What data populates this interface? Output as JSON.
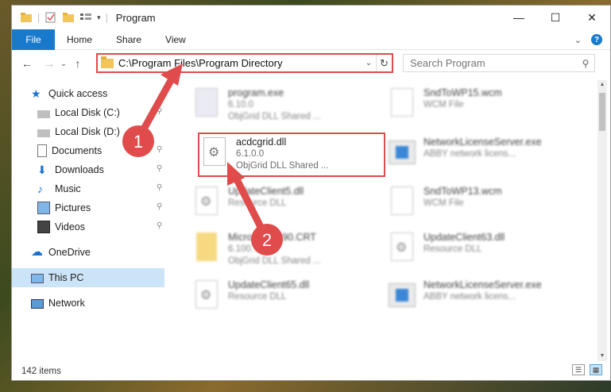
{
  "window": {
    "title": "Program",
    "controls": {
      "minimize": "—",
      "maximize": "☐",
      "close": "✕"
    }
  },
  "ribbon": {
    "file_tab": "File",
    "tabs": [
      "Home",
      "Share",
      "View"
    ]
  },
  "address_bar": {
    "path": "C:\\Program Files\\Program Directory"
  },
  "search": {
    "placeholder": "Search Program"
  },
  "sidebar": {
    "items": [
      {
        "label": "Quick access",
        "icon": "star-icon"
      },
      {
        "label": "Local Disk (C:)",
        "icon": "drive-icon"
      },
      {
        "label": "Local Disk (D:)",
        "icon": "drive-icon"
      },
      {
        "label": "Documents",
        "icon": "documents-icon"
      },
      {
        "label": "Downloads",
        "icon": "download-icon"
      },
      {
        "label": "Music",
        "icon": "music-icon"
      },
      {
        "label": "Pictures",
        "icon": "pictures-icon"
      },
      {
        "label": "Videos",
        "icon": "videos-icon"
      },
      {
        "label": "OneDrive",
        "icon": "cloud-icon"
      },
      {
        "label": "This PC",
        "icon": "computer-icon"
      },
      {
        "label": "Network",
        "icon": "network-icon"
      }
    ]
  },
  "files": [
    {
      "name": "program.exe",
      "line2": "6.10.0",
      "line3": "ObjGrid DLL Shared ...",
      "icon": "exe-icon"
    },
    {
      "name": "SndToWP15.wcm",
      "line2": "WCM File",
      "line3": "",
      "icon": "document-icon"
    },
    {
      "name": "acdcgrid.dll",
      "line2": "6.1.0.0",
      "line3": "ObjGrid DLL Shared ...",
      "icon": "dll-gear-icon"
    },
    {
      "name": "NetworkLicenseServer.exe",
      "line2": "ABBY network licens...",
      "line3": "",
      "icon": "app-icon"
    },
    {
      "name": "UpdateClient5.dll",
      "line2": "Resource DLL",
      "line3": "",
      "icon": "dll-gear-icon"
    },
    {
      "name": "SndToWP13.wcm",
      "line2": "WCM File",
      "line3": "",
      "icon": "document-icon"
    },
    {
      "name": "MicrosoftVC90.CRT",
      "line2": "6.100...",
      "line3": "ObjGrid DLL Shared ...",
      "icon": "folder-icon"
    },
    {
      "name": "UpdateClient63.dll",
      "line2": "Resource DLL",
      "line3": "",
      "icon": "dll-gear-icon"
    },
    {
      "name": "UpdateClient65.dll",
      "line2": "Resource DLL",
      "line3": "",
      "icon": "dll-gear-icon"
    },
    {
      "name": "NetworkLicenseServer.exe",
      "line2": "ABBY network licens...",
      "line3": "",
      "icon": "app-icon"
    }
  ],
  "status": {
    "item_count": "142 items"
  },
  "annotations": {
    "step1": "1",
    "step2": "2",
    "color": "#e04b4b"
  }
}
